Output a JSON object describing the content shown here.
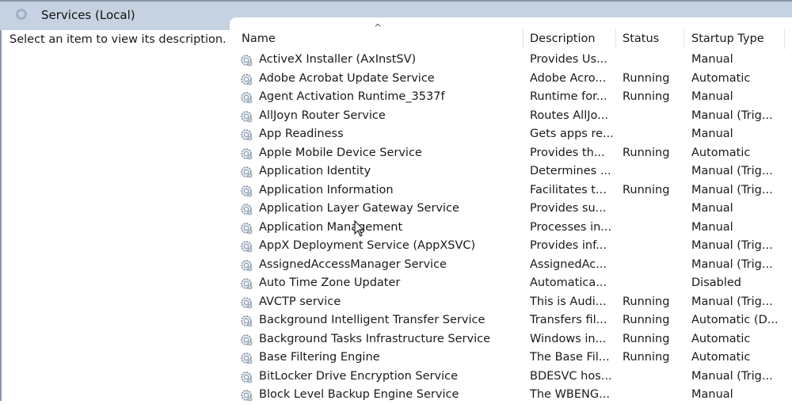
{
  "header": {
    "title": "Services (Local)",
    "icon": "services-gear-icon"
  },
  "left_pane": {
    "description": "Select an item to view its description."
  },
  "columns": [
    "Name",
    "Description",
    "Status",
    "Startup Type"
  ],
  "rows": [
    [
      "ActiveX Installer (AxInstSV)",
      "Provides Us...",
      "",
      "Manual"
    ],
    [
      "Adobe Acrobat Update Service",
      "Adobe Acro...",
      "Running",
      "Automatic"
    ],
    [
      "Agent Activation Runtime_3537f",
      "Runtime for...",
      "Running",
      "Manual"
    ],
    [
      "AllJoyn Router Service",
      "Routes AllJo...",
      "",
      "Manual (Trig..."
    ],
    [
      "App Readiness",
      "Gets apps re...",
      "",
      "Manual"
    ],
    [
      "Apple Mobile Device Service",
      "Provides th...",
      "Running",
      "Automatic"
    ],
    [
      "Application Identity",
      "Determines ...",
      "",
      "Manual (Trig..."
    ],
    [
      "Application Information",
      "Facilitates t...",
      "Running",
      "Manual (Trig..."
    ],
    [
      "Application Layer Gateway Service",
      "Provides su...",
      "",
      "Manual"
    ],
    [
      "Application Management",
      "Processes in...",
      "",
      "Manual"
    ],
    [
      "AppX Deployment Service (AppXSVC)",
      "Provides inf...",
      "",
      "Manual (Trig..."
    ],
    [
      "AssignedAccessManager Service",
      "AssignedAc...",
      "",
      "Manual (Trig..."
    ],
    [
      "Auto Time Zone Updater",
      "Automatica...",
      "",
      "Disabled"
    ],
    [
      "AVCTP service",
      "This is Audi...",
      "Running",
      "Manual (Trig..."
    ],
    [
      "Background Intelligent Transfer Service",
      "Transfers fil...",
      "Running",
      "Automatic (D..."
    ],
    [
      "Background Tasks Infrastructure Service",
      "Windows in...",
      "Running",
      "Automatic"
    ],
    [
      "Base Filtering Engine",
      "The Base Fil...",
      "Running",
      "Automatic"
    ],
    [
      "BitLocker Drive Encryption Service",
      "BDESVC hos...",
      "",
      "Manual (Trig..."
    ],
    [
      "Block Level Backup Engine Service",
      "The WBENG...",
      "",
      "Manual"
    ]
  ]
}
